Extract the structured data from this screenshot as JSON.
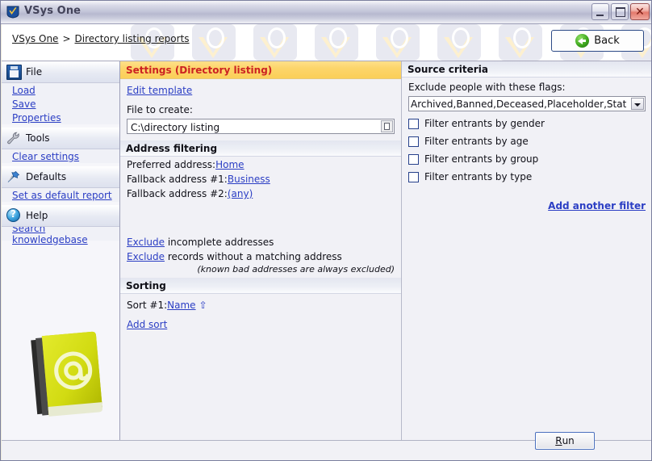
{
  "window": {
    "title": "VSys One",
    "icon": "vsys-shield-icon",
    "minimize_label": "Minimize",
    "maximize_label": "Maximize",
    "close_label": "Close"
  },
  "breadcrumb": {
    "root": "VSys One",
    "separator": ">",
    "current": "Directory listing reports"
  },
  "back_button": {
    "label": "Back",
    "icon": "back-arrow-icon"
  },
  "sidebar": {
    "groups": [
      {
        "label": "File",
        "icon": "floppy-disk-icon",
        "items": [
          "Load",
          "Save",
          "Properties"
        ]
      },
      {
        "label": "Tools",
        "icon": "wrench-icon",
        "items": [
          "Clear settings"
        ]
      },
      {
        "label": "Defaults",
        "icon": "pushpin-icon",
        "items": [
          "Set as default report"
        ]
      },
      {
        "label": "Help",
        "icon": "help-circle-icon",
        "items": [
          "Search knowledgebase"
        ]
      }
    ],
    "decoration_icon": "address-book-at-icon"
  },
  "settings": {
    "panel_title": "Settings (Directory listing)",
    "edit_template_link": "Edit template",
    "file_to_create_label": "File to create:",
    "file_to_create_value": "C:\\directory listing",
    "file_browse_icon": "document-browse-icon",
    "address_filtering": {
      "header": "Address filtering",
      "preferred_label": "Preferred address:",
      "preferred_value": "Home",
      "fallback1_label": "Fallback address #1:",
      "fallback1_value": "Business",
      "fallback2_label": "Fallback address #2:",
      "fallback2_value": "(any)",
      "exclude_link": "Exclude",
      "exclude_incomplete_text": "incomplete addresses",
      "exclude_nomatch_text": "records without a matching address",
      "note": "(known bad addresses are always excluded)"
    },
    "sorting": {
      "header": "Sorting",
      "sort1_label": "Sort #1:",
      "sort1_value": "Name",
      "sort1_direction_icon": "sort-ascending-icon",
      "add_sort_link": "Add sort"
    }
  },
  "source_criteria": {
    "header": "Source criteria",
    "exclude_flags_label": "Exclude people with these flags:",
    "exclude_flags_value": "Archived,Banned,Deceased,Placeholder,Status: Applica",
    "filters": [
      {
        "label": "Filter entrants by gender",
        "checked": false
      },
      {
        "label": "Filter entrants by age",
        "checked": false
      },
      {
        "label": "Filter entrants by group",
        "checked": false
      },
      {
        "label": "Filter entrants by type",
        "checked": false
      }
    ],
    "add_another_filter_link": "Add another filter"
  },
  "footer": {
    "run_button_accel": "R",
    "run_button_rest": "un"
  },
  "colors": {
    "panel_title_bg": "#fbcf58",
    "panel_title_fg": "#cc2222",
    "link": "#2b3ec4",
    "accent_blue": "#26408b"
  }
}
